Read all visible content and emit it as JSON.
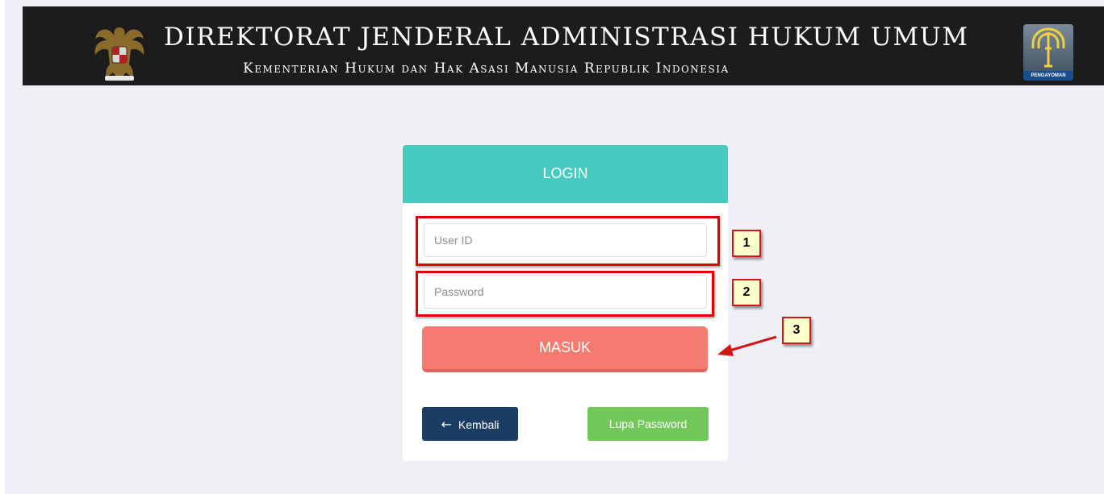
{
  "header": {
    "title": "DIREKTORAT JENDERAL ADMINISTRASI HUKUM UMUM",
    "subtitle": "Kementerian Hukum dan Hak Asasi Manusia Republik Indonesia",
    "left_emblem": "garuda-pancasila-emblem",
    "right_logo": "pengayoman-logo",
    "right_logo_text": "PENGAYOMAN"
  },
  "login": {
    "title": "LOGIN",
    "userid_placeholder": "User ID",
    "password_placeholder": "Password",
    "submit_label": "MASUK",
    "back_label": "Kembali",
    "back_icon": "arrow-left-icon",
    "forgot_label": "Lupa Password"
  },
  "annotations": {
    "step1": "1",
    "step2": "2",
    "step3": "3"
  },
  "colors": {
    "header_bg": "#1c1c1c",
    "page_bg": "#eef0f6",
    "card_header": "#45cbc0",
    "submit": "#f57b70",
    "back": "#1c3d63",
    "forgot": "#72c95a",
    "highlight": "#e00000",
    "badge_bg": "#ffffcc"
  }
}
